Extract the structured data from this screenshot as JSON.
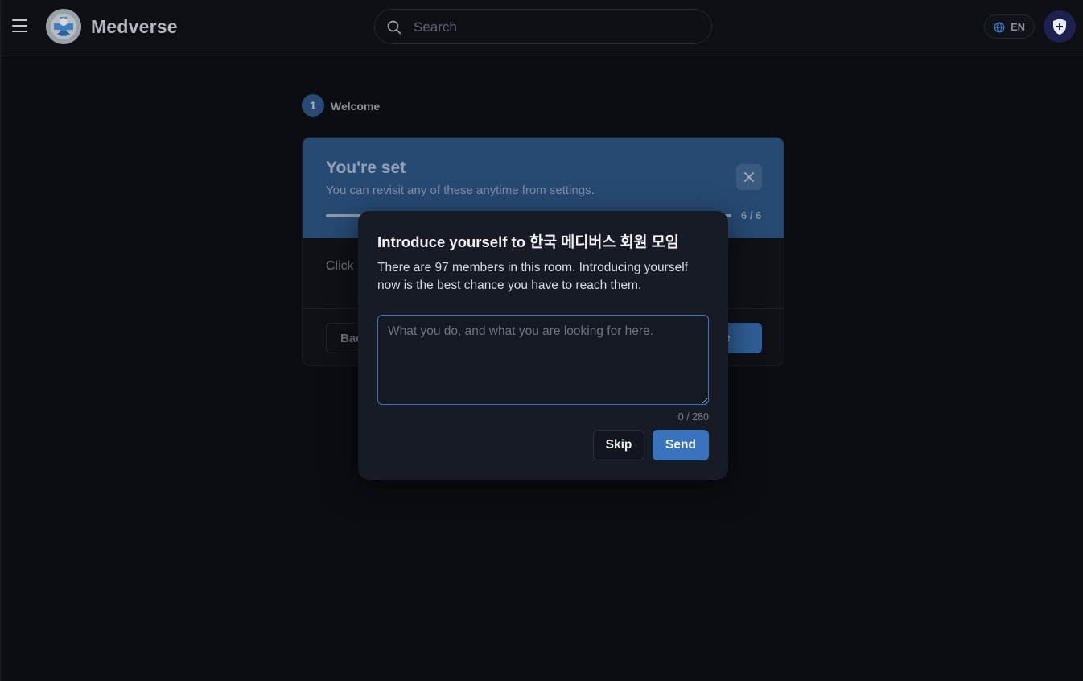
{
  "header": {
    "brand": "Medverse",
    "search_placeholder": "Search",
    "language": "EN"
  },
  "onboarding": {
    "step_number": "1",
    "step_label": "Welcome",
    "title": "You're set",
    "subtitle": "You can revisit any of these anytime from settings.",
    "progress_text": "6 / 6",
    "progress_fraction": 1.0,
    "body_text": "Click",
    "back_label": "Bac",
    "complete_label": "ete"
  },
  "modal": {
    "title": "Introduce yourself to 한국 메디버스 회원 모임",
    "description": "There are 97 members in this room. Introducing yourself now is the best chance you have to reach them.",
    "textarea_placeholder": "What you do, and what you are looking for here.",
    "char_count": "0 / 280",
    "skip_label": "Skip",
    "send_label": "Send"
  },
  "colors": {
    "accent": "#3a73bd",
    "background": "#0b0d12",
    "modal_bg": "#161b26",
    "onboarding_header": "#274a73"
  },
  "icons": [
    "menu-icon",
    "medverse-logo",
    "search-icon",
    "globe-icon",
    "shield-icon",
    "close-icon"
  ]
}
